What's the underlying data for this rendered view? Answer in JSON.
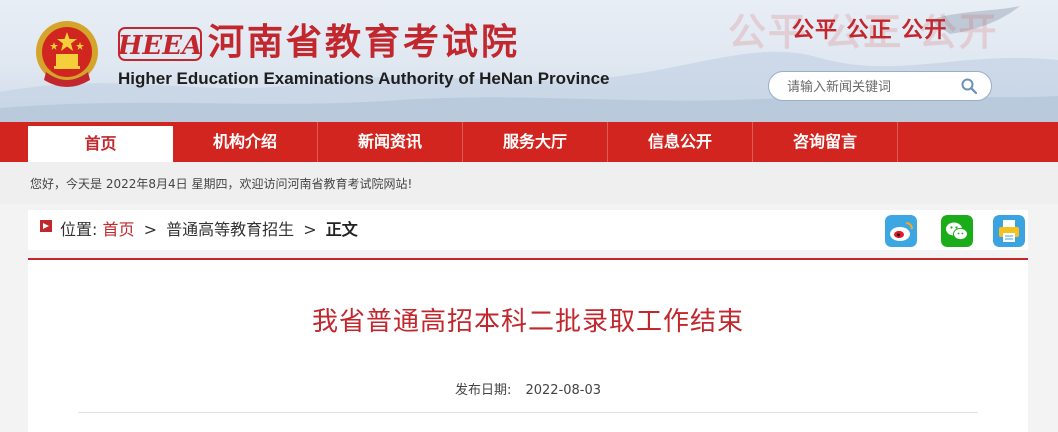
{
  "header": {
    "logo_mark": "HEEA",
    "title_cn": "河南省教育考试院",
    "title_en": "Higher Education Examinations Authority of HeNan Province",
    "slogan_ghost": "公平 公正 公开",
    "slogan": "公平 公正 公开",
    "search_placeholder": "请输入新闻关键词",
    "colors": {
      "brand_red": "#c1272d",
      "nav_red": "#d3251f"
    }
  },
  "nav": {
    "items": [
      {
        "label": "首页",
        "active": true
      },
      {
        "label": "机构介绍"
      },
      {
        "label": "新闻资讯"
      },
      {
        "label": "服务大厅"
      },
      {
        "label": "信息公开"
      },
      {
        "label": "咨询留言"
      }
    ]
  },
  "welcome": {
    "text": "您好，今天是 2022年8月4日 星期四，欢迎访问河南省教育考试院网站!"
  },
  "breadcrumb": {
    "label": "位置:",
    "home": "首页",
    "section": "普通高等教育招生",
    "current": "正文",
    "separator": ">"
  },
  "share": {
    "icons": [
      "weibo-icon",
      "wechat-icon",
      "print-icon"
    ]
  },
  "article": {
    "title": "我省普通高招本科二批录取工作结束",
    "date_label": "发布日期:",
    "date": "2022-08-03"
  }
}
